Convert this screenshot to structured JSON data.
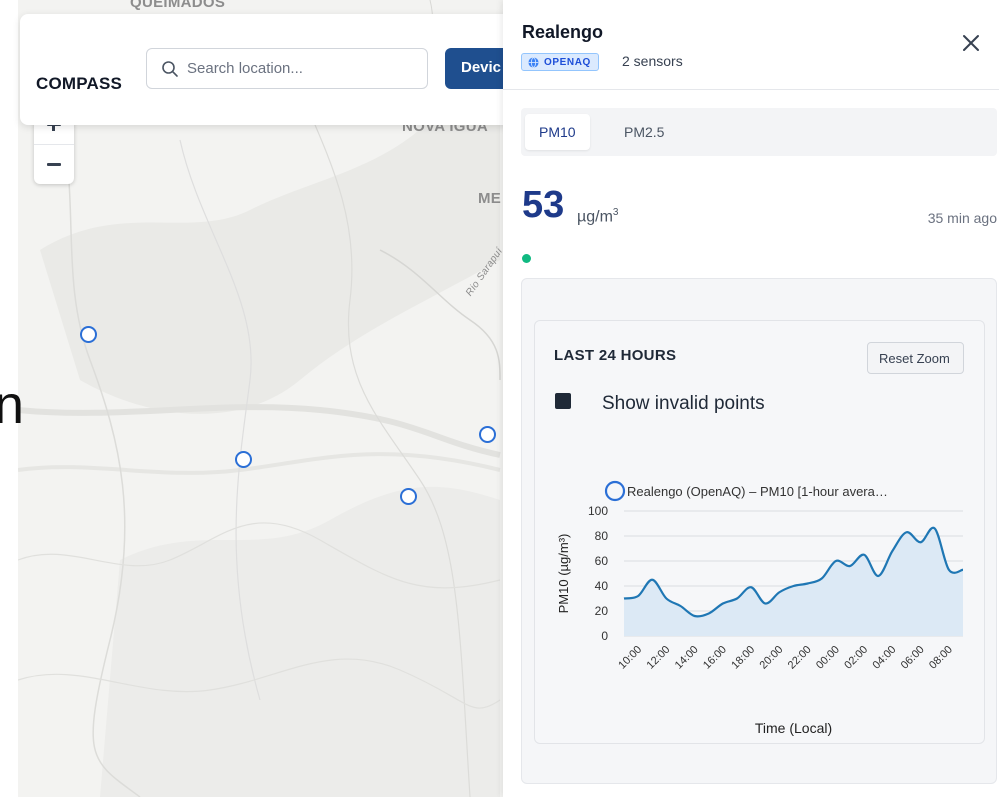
{
  "map": {
    "labels": {
      "top": "QUEIMADOS",
      "nova": "NOVA IGUA",
      "me": "ME",
      "river": "Rio Sarapuí"
    },
    "fragment_text": "n",
    "zoom_in_icon": "plus-icon",
    "zoom_out_icon": "minus-icon",
    "marker_color": "#2b6fd6"
  },
  "topbar": {
    "brand": "COMPASS",
    "search_placeholder": "Search location...",
    "search_icon": "search-icon",
    "devices_label": "Devic"
  },
  "panel": {
    "location_name": "Realengo",
    "source_badge": "OPENAQ",
    "source_icon": "globe-icon",
    "sensor_count": "2 sensors",
    "close_icon": "close-icon",
    "tabs": [
      {
        "label": "PM10",
        "active": true
      },
      {
        "label": "PM2.5",
        "active": false
      }
    ],
    "reading": {
      "value": "53",
      "unit_base": "µg/m",
      "unit_exp": "3",
      "age": "35 min ago",
      "status_color": "#10b981"
    },
    "chart_card": {
      "title": "LAST 24 HOURS",
      "reset_label": "Reset Zoom",
      "invalid_label": "Show invalid points",
      "invalid_checked": true
    }
  },
  "chart_data": {
    "type": "area",
    "legend": "Realengo (OpenAQ) – PM10 [1-hour avera…",
    "legend_placement": "top",
    "xlabel": "Time (Local)",
    "ylabel": "PM10 (µg/m³)",
    "ylim": [
      0,
      100
    ],
    "yticks": [
      0,
      20,
      40,
      60,
      80,
      100
    ],
    "xticks": [
      "10:00",
      "12:00",
      "14:00",
      "16:00",
      "18:00",
      "20:00",
      "22:00",
      "00:00",
      "02:00",
      "04:00",
      "06:00",
      "08:00"
    ],
    "grid": "horizontal",
    "line_color": "#1f77b4",
    "fill_color": "#dce9f5",
    "series": [
      {
        "x": [
          "09:00",
          "10:00",
          "11:00",
          "12:00",
          "13:00",
          "14:00",
          "15:00",
          "16:00",
          "17:00",
          "18:00",
          "19:00",
          "20:00",
          "21:00",
          "22:00",
          "23:00",
          "00:00",
          "01:00",
          "02:00",
          "03:00",
          "04:00",
          "05:00",
          "06:00",
          "07:00",
          "08:00",
          "09:00"
        ],
        "y": [
          30,
          32,
          45,
          30,
          24,
          16,
          18,
          26,
          30,
          39,
          26,
          35,
          40,
          42,
          46,
          60,
          56,
          65,
          48,
          68,
          83,
          75,
          86,
          53,
          53
        ]
      }
    ]
  }
}
